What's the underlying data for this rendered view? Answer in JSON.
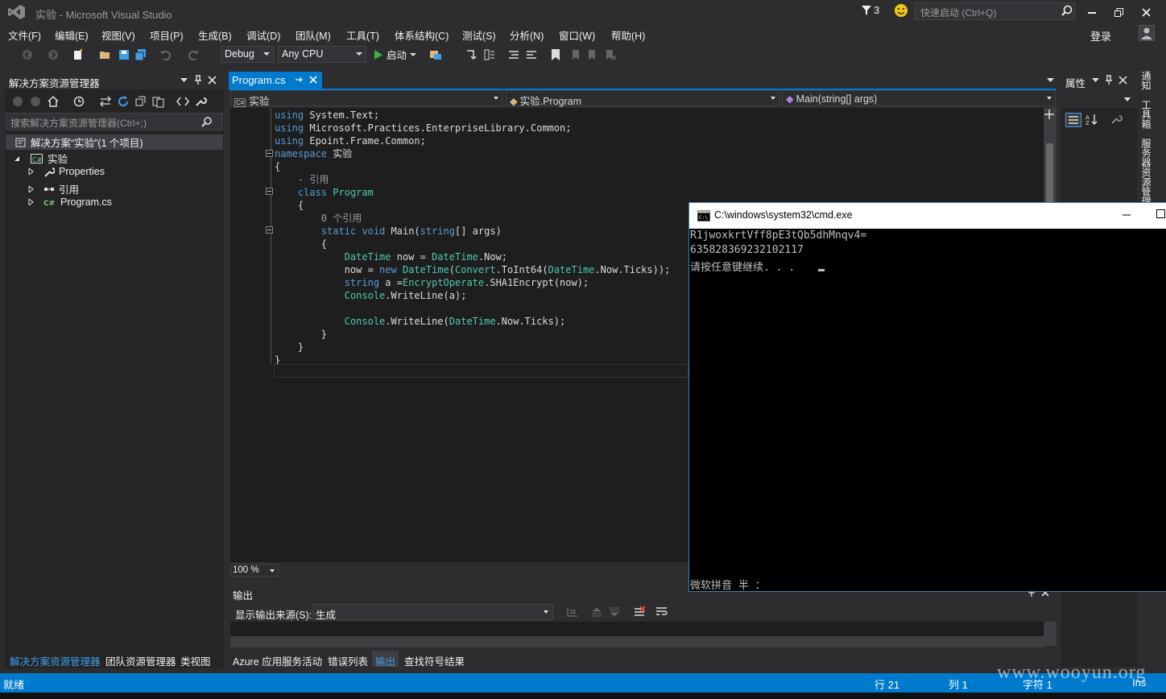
{
  "window": {
    "title": "实验 - Microsoft Visual Studio",
    "notification_count": "3",
    "quick_launch_placeholder": "快速启动 (Ctrl+Q)",
    "login": "登录"
  },
  "menu": [
    "文件(F)",
    "编辑(E)",
    "视图(V)",
    "项目(P)",
    "生成(B)",
    "调试(D)",
    "团队(M)",
    "工具(T)",
    "体系结构(C)",
    "测试(S)",
    "分析(N)",
    "窗口(W)",
    "帮助(H)"
  ],
  "toolbar": {
    "config": "Debug",
    "platform": "Any CPU",
    "start": "启动"
  },
  "solution_explorer": {
    "title": "解决方案资源管理器",
    "search_placeholder": "搜索解决方案资源管理器(Ctrl+;)",
    "solution": "解决方案“实验”(1 个项目)",
    "project": "实验",
    "items": [
      "Properties",
      "引用",
      "Program.cs"
    ]
  },
  "left_tabs": [
    "解决方案资源管理器",
    "团队资源管理器",
    "类视图"
  ],
  "editor": {
    "tab": "Program.cs",
    "nav_project": "实验",
    "nav_class": "实验.Program",
    "nav_member": "Main(string[] args)",
    "zoom": "100 %",
    "lines": [
      [
        [
          "kw",
          "using"
        ],
        [
          "tx",
          " System.Text;"
        ]
      ],
      [
        [
          "kw",
          "using"
        ],
        [
          "tx",
          " Microsoft.Practices.EnterpriseLibrary.Common;"
        ]
      ],
      [
        [
          "kw",
          "using"
        ],
        [
          "tx",
          " Epoint.Frame.Common;"
        ]
      ],
      [
        [
          "kw",
          "namespace"
        ],
        [
          "tx",
          " 实验"
        ]
      ],
      [
        [
          "tx",
          "{"
        ]
      ],
      [
        [
          "cm",
          "    - 引用"
        ]
      ],
      [
        [
          "tx",
          "    "
        ],
        [
          "kw",
          "class"
        ],
        [
          "tx",
          " "
        ],
        [
          "ty",
          "Program"
        ]
      ],
      [
        [
          "tx",
          "    {"
        ]
      ],
      [
        [
          "cm",
          "        0 个引用"
        ]
      ],
      [
        [
          "tx",
          "        "
        ],
        [
          "kw",
          "static"
        ],
        [
          "tx",
          " "
        ],
        [
          "kw",
          "void"
        ],
        [
          "tx",
          " Main("
        ],
        [
          "kw",
          "string"
        ],
        [
          "tx",
          "[] args)"
        ]
      ],
      [
        [
          "tx",
          "        {"
        ]
      ],
      [
        [
          "tx",
          "            "
        ],
        [
          "ty",
          "DateTime"
        ],
        [
          "tx",
          " now = "
        ],
        [
          "ty",
          "DateTime"
        ],
        [
          "tx",
          ".Now;"
        ]
      ],
      [
        [
          "tx",
          "            now = "
        ],
        [
          "kw",
          "new"
        ],
        [
          "tx",
          " "
        ],
        [
          "ty",
          "DateTime"
        ],
        [
          "tx",
          "("
        ],
        [
          "ty",
          "Convert"
        ],
        [
          "tx",
          ".ToInt64("
        ],
        [
          "ty",
          "DateTime"
        ],
        [
          "tx",
          ".Now.Ticks));"
        ]
      ],
      [
        [
          "tx",
          "            "
        ],
        [
          "kw",
          "string"
        ],
        [
          "tx",
          " a ="
        ],
        [
          "ty",
          "EncryptOperate"
        ],
        [
          "tx",
          ".SHA1Encrypt(now);"
        ]
      ],
      [
        [
          "tx",
          "            "
        ],
        [
          "ty",
          "Console"
        ],
        [
          "tx",
          ".WriteLine(a);"
        ]
      ],
      [
        [
          "tx",
          ""
        ]
      ],
      [
        [
          "tx",
          "            "
        ],
        [
          "ty",
          "Console"
        ],
        [
          "tx",
          ".WriteLine("
        ],
        [
          "ty",
          "DateTime"
        ],
        [
          "tx",
          ".Now.Ticks);"
        ]
      ],
      [
        [
          "tx",
          "        }"
        ]
      ],
      [
        [
          "tx",
          "    }"
        ]
      ],
      [
        [
          "tx",
          "}"
        ]
      ]
    ]
  },
  "output": {
    "title": "输出",
    "source_label": "显示输出来源(S):",
    "source_value": "生成"
  },
  "bottom_tabs": [
    "Azure 应用服务活动",
    "错误列表",
    "输出",
    "查找符号结果"
  ],
  "properties": {
    "title": "属性"
  },
  "right_vertical_tabs": [
    "通知",
    "工具箱",
    "服务器资源管理"
  ],
  "cmd": {
    "title": "C:\\windows\\system32\\cmd.exe",
    "lines": [
      "R1jwoxkrtVff8pE3tQb5dhMnqv4=",
      "635828369232102117",
      "请按任意键继续. . . "
    ],
    "ime": "微软拼音 半 ："
  },
  "status": {
    "left": "就绪",
    "row": "行 21",
    "col": "列 1",
    "char": "字符 1",
    "mode": "Ins"
  },
  "watermark": "www.wooyun.org"
}
